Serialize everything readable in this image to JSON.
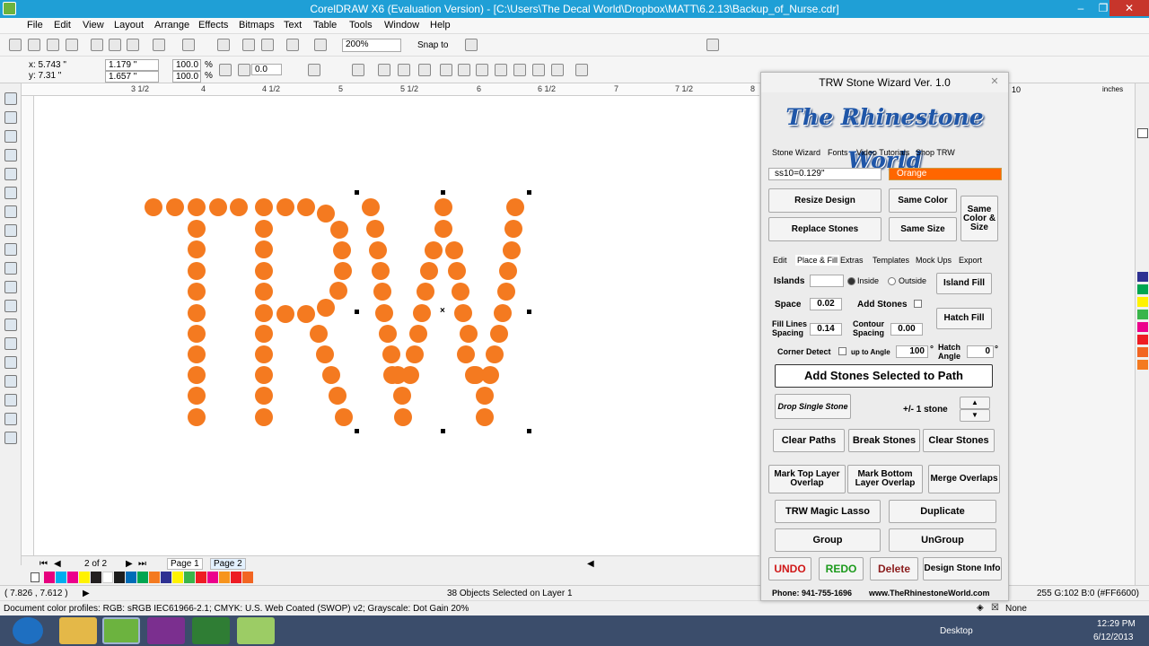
{
  "window": {
    "title": "CorelDRAW X6 (Evaluation Version) - [C:\\Users\\The Decal World\\Dropbox\\MATT\\6.2.13\\Backup_of_Nurse.cdr]",
    "minimize": "–",
    "maximize": "❐",
    "close": "✕"
  },
  "menubar": [
    "File",
    "Edit",
    "View",
    "Layout",
    "Arrange",
    "Effects",
    "Bitmaps",
    "Text",
    "Table",
    "Tools",
    "Window",
    "Help"
  ],
  "toolbar": {
    "zoom": "200%",
    "snap_to": "Snap to",
    "x": "x: 5.743 \"",
    "y": "y: 7.31 \"",
    "w": "1.179 \"",
    "h": "1.657 \"",
    "scale_x": "100.0",
    "scale_y": "100.0",
    "pct": "%",
    "rotation": "0.0"
  },
  "ruler": {
    "labels": [
      "3 1/2",
      "4",
      "4 1/2",
      "5",
      "5 1/2",
      "6",
      "6 1/2",
      "7",
      "7 1/2",
      "8"
    ],
    "right_label": "10",
    "units": "inches"
  },
  "navigation": {
    "page_count": "2 of 2",
    "tabs": [
      "Page 1",
      "Page 2"
    ]
  },
  "status": {
    "cursor_pos": "( 7.826 , 7.612 )",
    "selection_info": "38 Objects Selected on Layer 1",
    "color_profiles": "Document color profiles: RGB: sRGB IEC61966-2.1; CMYK: U.S. Web Coated (SWOP) v2; Grayscale: Dot Gain 20%",
    "fill_info": "255 G:102 B:0 (#FF6600)",
    "outline": "None"
  },
  "taskbar": {
    "desktop": "Desktop",
    "time": "12:29 PM",
    "date": "6/12/2013"
  },
  "wizard": {
    "title": "TRW Stone Wizard Ver. 1.0",
    "close": "✕",
    "logo": "The Rhinestone World",
    "top_tabs": [
      "Stone Wizard",
      "Fonts",
      "Video Tutorials",
      "Shop TRW"
    ],
    "stone_size": "ss10=0.129\"",
    "stone_color": "Orange",
    "resize_design": "Resize Design",
    "same_color": "Same Color",
    "same_color_size": "Same Color & Size",
    "replace_stones": "Replace Stones",
    "same_size": "Same Size",
    "sub_tabs": [
      "Edit",
      "Place & Fill",
      "Extras",
      "Templates",
      "Mock Ups",
      "Export"
    ],
    "islands": "Islands",
    "inside": "Inside",
    "outside": "Outside",
    "island_fill": "Island Fill",
    "space": "Space",
    "space_value": "0.02",
    "add_stones": "Add Stones",
    "fill_lines_spacing": "Fill Lines Spacing",
    "fill_lines_value": "0.14",
    "contour_spacing": "Contour Spacing",
    "contour_value": "0.00",
    "hatch_fill": "Hatch Fill",
    "corner_detect": "Corner Detect",
    "up_to_angle": "up to Angle",
    "angle_value": "100",
    "hatch_angle": "Hatch Angle",
    "hatch_angle_value": "0",
    "deg": "°",
    "add_stones_path": "Add Stones Selected to Path",
    "drop_single": "Drop Single Stone",
    "plus_minus": "+/- 1 stone",
    "clear_paths": "Clear Paths",
    "break_stones": "Break Stones",
    "clear_stones": "Clear Stones",
    "mark_top": "Mark Top Layer Overlap",
    "mark_bottom": "Mark Bottom Layer Overlap",
    "merge_overlaps": "Merge Overlaps",
    "magic_lasso": "TRW Magic Lasso",
    "duplicate": "Duplicate",
    "group": "Group",
    "ungroup": "UnGroup",
    "undo": "UNDO",
    "redo": "REDO",
    "delete": "Delete",
    "design_info": "Design Stone Info",
    "phone": "Phone: 941-755-1696",
    "website": "www.TheRhinestoneWorld.com"
  },
  "colors": {
    "stone": "#f47a20",
    "title_bar": "#1f9fd6",
    "undo": "#d01818",
    "redo": "#1b9a1b"
  }
}
